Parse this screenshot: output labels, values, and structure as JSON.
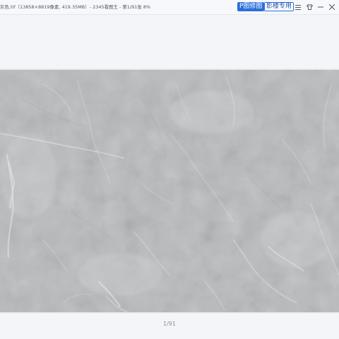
{
  "window": {
    "title": "灰色.tif（13858×8819像素, 419.35MB）- 2345看图王 - 第1/91张 8%"
  },
  "toolbar": {
    "p_edit_label": "P图修图",
    "studio_label": "影楼专用"
  },
  "window_controls": {
    "menu_icon": "hamburger-menu-icon",
    "skin_icon": "shirt-icon",
    "minimize_icon": "minimize-icon",
    "close_icon": "close-icon"
  },
  "viewer": {
    "page_indicator": "1/91"
  },
  "colors": {
    "accent": "#2a6fdb",
    "marble_base": "#b8b9bb"
  }
}
